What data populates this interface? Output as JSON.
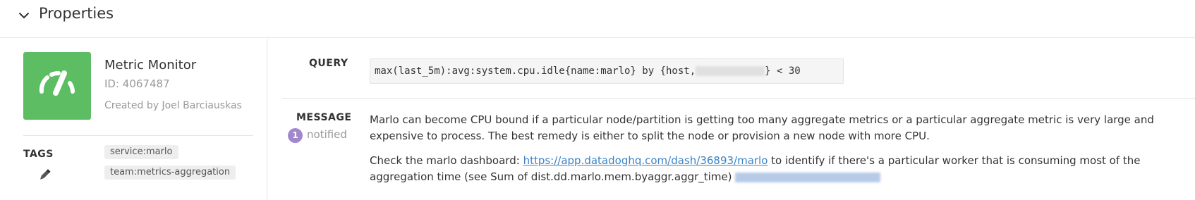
{
  "header": {
    "title": "Properties",
    "collapse_icon": "chevron-down-icon"
  },
  "monitor": {
    "icon": "gauge-icon",
    "icon_color": "#5cbd63",
    "name": "Metric Monitor",
    "id_text": "ID: 4067487",
    "created_by": "Created by Joel Barciauskas"
  },
  "tags": {
    "label": "TAGS",
    "edit_icon": "pencil-icon",
    "items": [
      "service:marlo",
      "team:metrics-aggregation"
    ]
  },
  "query": {
    "label": "QUERY",
    "text_before": "max(last_5m):avg:system.cpu.idle{name:marlo} by {host,",
    "text_after": "} < 30"
  },
  "message": {
    "label": "MESSAGE",
    "notified_count": "1",
    "notified_label": "notified",
    "badge_color": "#a387cc",
    "paragraph1": "Marlo can become CPU bound if a particular node/partition is getting too many aggregate metrics or a particular aggregate metric is very large and expensive to process. The best remedy is either to split the node or provision a new node with more CPU.",
    "paragraph2_prefix": "Check the marlo dashboard: ",
    "link_text": "https://app.datadoghq.com/dash/36893/marlo",
    "paragraph2_suffix": " to identify if there's a particular worker that is consuming most of the aggregation time (see Sum of dist.dd.marlo.mem.byaggr.aggr_time)"
  }
}
